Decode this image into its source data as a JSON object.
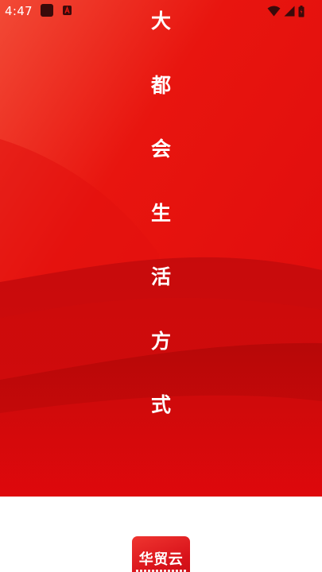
{
  "status_bar": {
    "time": "4:47",
    "notification_icons": [
      "app-notification-icon",
      "a-badge-icon"
    ],
    "system_icons": [
      "wifi-icon",
      "signal-icon",
      "battery-icon"
    ]
  },
  "splash": {
    "slogan_chars": [
      "大",
      "都",
      "会",
      "生",
      "活",
      "方",
      "式"
    ],
    "background_colors": [
      "#f03a2e",
      "#e60012",
      "#c40a0f",
      "#a80608"
    ]
  },
  "logo": {
    "text": "华贸云",
    "color": "#e0151d"
  }
}
